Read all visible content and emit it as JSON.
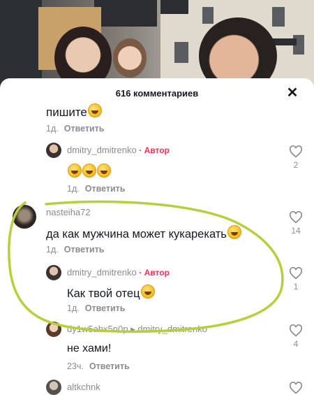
{
  "header": {
    "title": "616 комментариев",
    "close_icon": "close-icon"
  },
  "comments": [
    {
      "text": "пишите",
      "emoji": true,
      "time": "1д.",
      "reply": "Ответить"
    },
    {
      "user": "dmitry_dmitrenko",
      "author_badge": "· Автор",
      "emoji_count": 3,
      "time": "1д.",
      "reply": "Ответить",
      "likes": "2"
    },
    {
      "user": "nasteiha72",
      "text": "да как мужчина может кукарекать",
      "emoji": true,
      "time": "1д.",
      "reply": "Ответить",
      "likes": "14"
    },
    {
      "user": "dmitry_dmitrenko",
      "author_badge": "· Автор",
      "text": "Как твой отец",
      "emoji": true,
      "time": "1д.",
      "reply": "Ответить",
      "likes": "1"
    },
    {
      "user": "dy1w5abx5n0p",
      "reply_to": "▸ dmitry_dmitrenko",
      "text": "не хами!",
      "time": "23ч.",
      "reply": "Ответить",
      "likes": "4"
    },
    {
      "user": "altkchnk"
    }
  ],
  "colors": {
    "author": "#fe2c55",
    "highlight_stroke": "#b6cf3c",
    "muted": "#8a8b91"
  }
}
